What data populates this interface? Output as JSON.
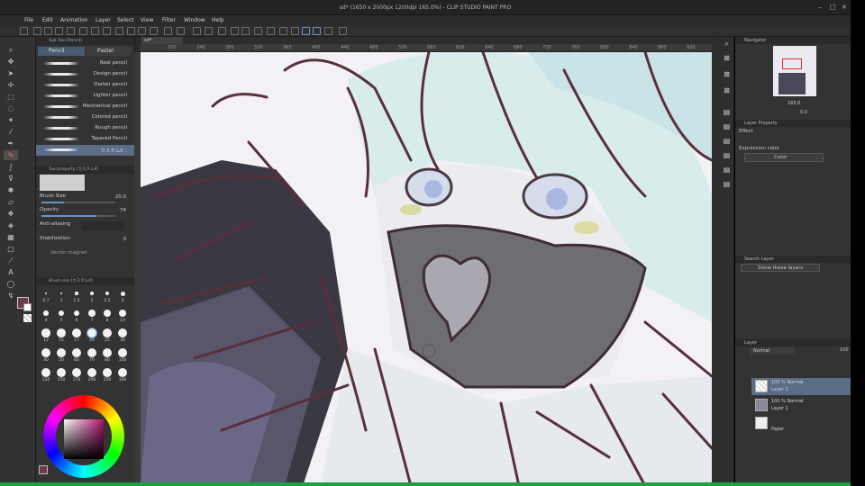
{
  "window": {
    "title": "sd* (1650 x 2000px 1200dpi 165.0%) - CLIP STUDIO PAINT PRO",
    "controls": [
      "–",
      "□",
      "✕"
    ]
  },
  "menu": [
    "File",
    "Edit",
    "Animation",
    "Layer",
    "Select",
    "View",
    "Filter",
    "Window",
    "Help"
  ],
  "subtool": {
    "header": "Sub Tool [Pencil]",
    "tabs": [
      "Pencil",
      "Pastel"
    ],
    "brushes": [
      "Real pencil",
      "Design pencil",
      "Darker pencil",
      "Lighter pencil",
      "Mechanical pencil",
      "Colored pencil",
      "Rough pencil",
      "Tapered Pencil",
      "カスタムP..."
    ]
  },
  "tool_property": {
    "header": "Tool property [カスタムP]",
    "brush_size_label": "Brush Size",
    "brush_size_value": "20.0",
    "opacity_label": "Opacity",
    "opacity_value": "74",
    "opacity_fraction": 0.74,
    "antialias_label": "Anti-aliasing",
    "stabilization_label": "Stabilization",
    "stabilization_value": "0",
    "vector_magnet_label": "Vector magnet"
  },
  "brush_size_panel": {
    "header": "Brush size [カスタムP]",
    "sizes": [
      "0.7",
      "1",
      "1.5",
      "2",
      "2.5",
      "3",
      "4",
      "5",
      "6",
      "7",
      "8",
      "10",
      "12",
      "15",
      "17",
      "20",
      "25",
      "30",
      "40",
      "50",
      "60",
      "70",
      "80",
      "100",
      "120",
      "150",
      "170",
      "200",
      "250",
      "300"
    ]
  },
  "canvas": {
    "tab_label": "sd*",
    "ruler_labels": [
      "200",
      "240",
      "280",
      "320",
      "360",
      "400",
      "440",
      "480",
      "520",
      "560",
      "600",
      "640",
      "680",
      "720",
      "760",
      "800",
      "840",
      "880",
      "920",
      "960"
    ]
  },
  "navigator": {
    "header": "Navigator",
    "zoom": "165.0",
    "rotation": "0.0"
  },
  "layer_property": {
    "header": "Layer Property",
    "effect_label": "Effect",
    "expression_color_label": "Expression color",
    "expression_color_value": "Color"
  },
  "search_layer": {
    "header": "Search Layer",
    "filter_value": "Show these layers"
  },
  "layers_panel": {
    "header": "Layer",
    "blend_mode": "Normal",
    "opacity": "100",
    "layers": [
      {
        "line1": "100 % Normal",
        "name": "Layer 2",
        "selected": true
      },
      {
        "line1": "100 % Normal",
        "name": "Layer 1",
        "selected": false
      },
      {
        "line1": "",
        "name": "Paper",
        "selected": false
      }
    ]
  },
  "colors": {
    "accent": "#6a93c7",
    "selected_layer": "#5a6c86",
    "status_bar": "#1aa33c",
    "main_color": "#6e3b4c"
  }
}
